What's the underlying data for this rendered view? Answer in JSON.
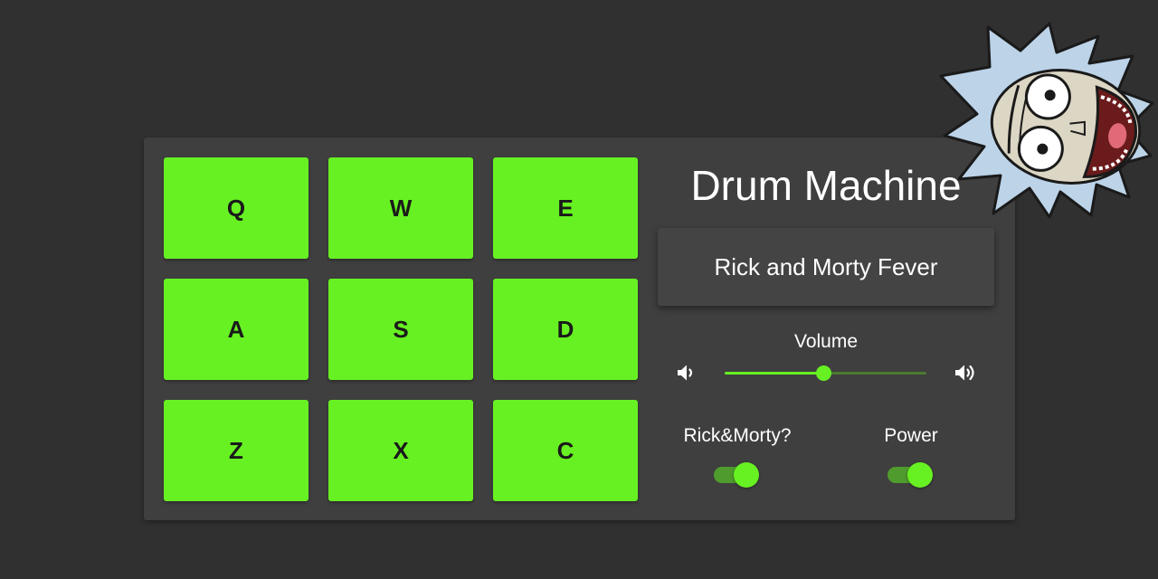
{
  "app": {
    "title": "Drum Machine"
  },
  "pads": [
    {
      "key": "Q"
    },
    {
      "key": "W"
    },
    {
      "key": "E"
    },
    {
      "key": "A"
    },
    {
      "key": "S"
    },
    {
      "key": "D"
    },
    {
      "key": "Z"
    },
    {
      "key": "X"
    },
    {
      "key": "C"
    }
  ],
  "display": {
    "text": "Rick and Morty Fever"
  },
  "volume": {
    "label": "Volume",
    "level": 0.49,
    "low_icon": "volume-low-icon",
    "high_icon": "volume-high-icon"
  },
  "toggles": {
    "rick_morty": {
      "label": "Rick&Morty?",
      "on": true
    },
    "power": {
      "label": "Power",
      "on": true
    }
  },
  "colors": {
    "background": "#303030",
    "panel": "#3f3f3f",
    "pad": "#67f122",
    "accent": "#67f122"
  },
  "decoration": {
    "image": "rick-face-icon"
  }
}
